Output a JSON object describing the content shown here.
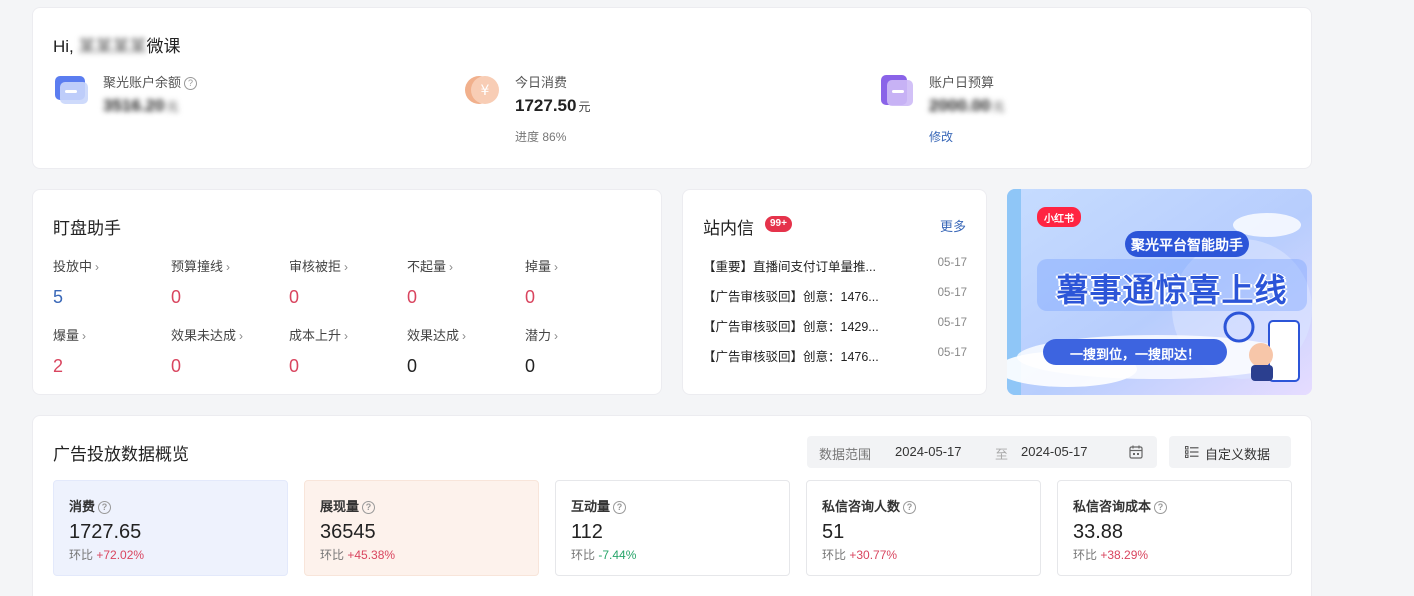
{
  "header": {
    "greeting_prefix": "Hi,",
    "greeting_hidden": "某某某某",
    "greeting_suffix": "微课"
  },
  "account": {
    "balance": {
      "label": "聚光账户余额",
      "value_hidden": "3516.20",
      "unit_hidden": "元"
    },
    "today_spend": {
      "label": "今日消费",
      "value": "1727.50",
      "unit": "元",
      "progress_label": "进度",
      "progress": "86%"
    },
    "daily_budget": {
      "label": "账户日预算",
      "value_hidden": "2000.00",
      "unit_hidden": "元",
      "edit_label": "修改"
    }
  },
  "monitor": {
    "title": "盯盘助手",
    "items": [
      {
        "label": "投放中",
        "value": "5",
        "tone": "blue"
      },
      {
        "label": "预算撞线",
        "value": "0",
        "tone": "red"
      },
      {
        "label": "审核被拒",
        "value": "0",
        "tone": "red"
      },
      {
        "label": "不起量",
        "value": "0",
        "tone": "red"
      },
      {
        "label": "掉量",
        "value": "0",
        "tone": "red"
      },
      {
        "label": "爆量",
        "value": "2",
        "tone": "red"
      },
      {
        "label": "效果未达成",
        "value": "0",
        "tone": "red"
      },
      {
        "label": "成本上升",
        "value": "0",
        "tone": "red"
      },
      {
        "label": "效果达成",
        "value": "0",
        "tone": "dark"
      },
      {
        "label": "潜力",
        "value": "0",
        "tone": "dark"
      }
    ]
  },
  "messages": {
    "title": "站内信",
    "badge": "99+",
    "more_label": "更多",
    "items": [
      {
        "text": "【重要】直播间支付订单量推...",
        "date": "05-17"
      },
      {
        "text": "【广告审核驳回】创意：1476...",
        "date": "05-17"
      },
      {
        "text": "【广告审核驳回】创意：1429...",
        "date": "05-17"
      },
      {
        "text": "【广告审核驳回】创意：1476...",
        "date": "05-17"
      }
    ]
  },
  "banner": {
    "brand_tag": "小红书",
    "headline_small": "聚光平台智能助手",
    "headline_big": "薯事通惊喜上线",
    "tagline": "一搜到位，一搜即达！"
  },
  "ads": {
    "title": "广告投放数据概览",
    "range_label": "数据范围",
    "date_start": "2024-05-17",
    "date_sep": "至",
    "date_end": "2024-05-17",
    "custom_label": "自定义数据",
    "change_prefix": "环比",
    "kpis": [
      {
        "label": "消费",
        "value": "1727.65",
        "change": "+72.02%",
        "dir": "up"
      },
      {
        "label": "展现量",
        "value": "36545",
        "change": "+45.38%",
        "dir": "up"
      },
      {
        "label": "互动量",
        "value": "112",
        "change": "-7.44%",
        "dir": "down"
      },
      {
        "label": "私信咨询人数",
        "value": "51",
        "change": "+30.77%",
        "dir": "up"
      },
      {
        "label": "私信咨询成本",
        "value": "33.88",
        "change": "+38.29%",
        "dir": "up"
      }
    ]
  },
  "colors": {
    "link": "#3a68b8",
    "alert": "#d9455f",
    "positive": "#27a56a",
    "badge": "#e5334b"
  }
}
